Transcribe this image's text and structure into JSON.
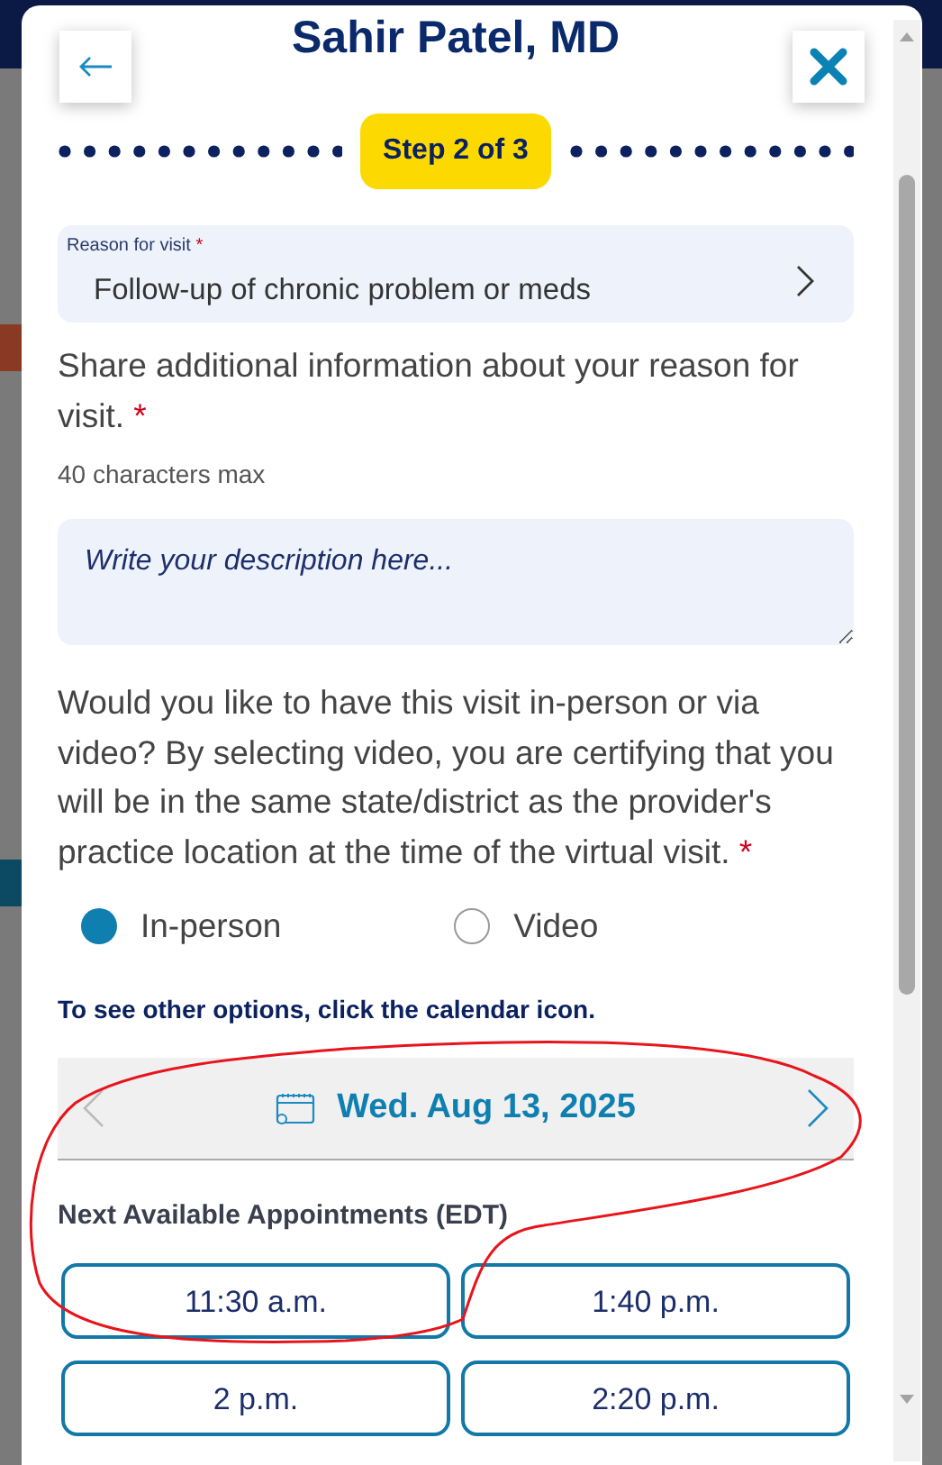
{
  "dialog": {
    "title": "Sahir Patel, MD",
    "step_label": "Step 2 of 3"
  },
  "reason_field": {
    "label": "Reason for visit",
    "required_mark": "*",
    "value": "Follow-up of chronic problem or meds"
  },
  "description": {
    "prompt": "Share additional information about your reason for visit.",
    "required_mark": "*",
    "hint": "40 characters max",
    "placeholder": "Write your description here..."
  },
  "visit_type": {
    "prompt": "Would you like to have this visit in-person or via video? By selecting video, you are certifying that you will be in the same state/district as the provider's practice location at the time of the virtual visit.",
    "required_mark": "*",
    "options": [
      {
        "label": "In-person",
        "selected": true
      },
      {
        "label": "Video",
        "selected": false
      }
    ]
  },
  "calendar_hint": "To see other options, click the calendar icon.",
  "date_bar": {
    "date": "Wed. Aug 13, 2025",
    "prev_disabled": true,
    "next_disabled": false
  },
  "appointments": {
    "heading": "Next Available Appointments (EDT)",
    "slots": [
      {
        "time": "11:30 a.m."
      },
      {
        "time": "1:40 p.m."
      },
      {
        "time": "2 p.m."
      },
      {
        "time": "2:20 p.m."
      }
    ]
  }
}
